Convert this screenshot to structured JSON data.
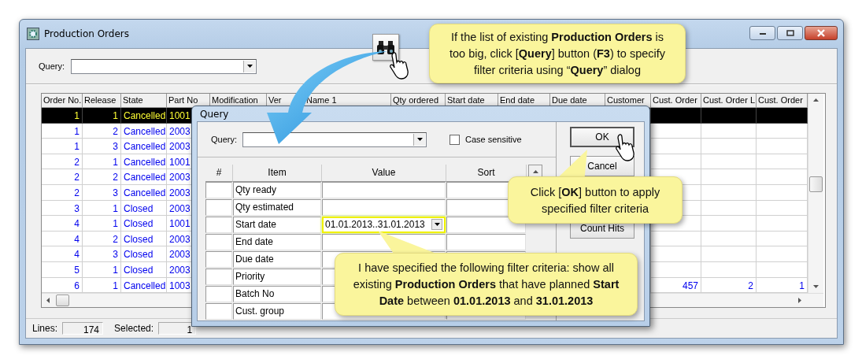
{
  "window": {
    "title": "Production Orders"
  },
  "query": {
    "label": "Query:"
  },
  "table": {
    "columns": [
      "Order No.",
      "Release",
      "State",
      "Part No",
      "Modification",
      "Ver",
      "Name 1",
      "Qty ordered",
      "Start date",
      "End date",
      "Due date",
      "Customer",
      "Cust. Order",
      "Cust. Order L",
      "Cust. Order"
    ],
    "rows": [
      {
        "order_no": "1",
        "release": "1",
        "state": "Cancelled",
        "part_no": "1001",
        "selected": true
      },
      {
        "order_no": "1",
        "release": "2",
        "state": "Cancelled",
        "part_no": "2003",
        "selected": false
      },
      {
        "order_no": "1",
        "release": "3",
        "state": "Cancelled",
        "part_no": "2003",
        "selected": false
      },
      {
        "order_no": "2",
        "release": "1",
        "state": "Cancelled",
        "part_no": "1001",
        "selected": false
      },
      {
        "order_no": "2",
        "release": "2",
        "state": "Cancelled",
        "part_no": "2003",
        "selected": false
      },
      {
        "order_no": "2",
        "release": "3",
        "state": "Cancelled",
        "part_no": "2003",
        "selected": false
      },
      {
        "order_no": "3",
        "release": "1",
        "state": "Closed",
        "part_no": "2003",
        "selected": false
      },
      {
        "order_no": "4",
        "release": "1",
        "state": "Closed",
        "part_no": "1001",
        "selected": false
      },
      {
        "order_no": "4",
        "release": "2",
        "state": "Closed",
        "part_no": "2003",
        "selected": false
      },
      {
        "order_no": "4",
        "release": "3",
        "state": "Closed",
        "part_no": "2003",
        "selected": false
      },
      {
        "order_no": "5",
        "release": "1",
        "state": "Closed",
        "part_no": "2003",
        "selected": false
      },
      {
        "order_no": "6",
        "release": "1",
        "state": "Cancelled",
        "part_no": "1003",
        "cust_order": "457",
        "cust_order_line": "2",
        "cust_order_2": "1",
        "selected": false
      }
    ]
  },
  "status_bar": {
    "lines_label": "Lines:",
    "lines": "174",
    "selected_label": "Selected:",
    "selected": "1"
  },
  "dialog": {
    "title": "Query",
    "query_label": "Query:",
    "case_sensitive": {
      "label": "Case sensitive",
      "checked": false
    },
    "columns": [
      "#",
      "Item",
      "Value",
      "Sort"
    ],
    "rows": [
      {
        "item": "Qty ready",
        "highlighted": false
      },
      {
        "item": "Qty estimated",
        "highlighted": false
      },
      {
        "item": "Start date",
        "value": "01.01.2013..31.01.2013",
        "highlighted": true
      },
      {
        "item": "End date",
        "highlighted": false
      },
      {
        "item": "Due date",
        "highlighted": false
      },
      {
        "item": "Priority",
        "highlighted": false
      },
      {
        "item": "Batch No",
        "highlighted": false
      },
      {
        "item": "Cust. group",
        "highlighted": false
      }
    ],
    "buttons": [
      {
        "label": "OK",
        "focused": true
      },
      {
        "label": "Cancel",
        "focused": false
      },
      {
        "label": "Count Hits",
        "focused": false
      }
    ]
  },
  "callouts": [
    {
      "text": "If the list of existing **Production Orders** is too big, click [**Query**] button (**F3**) to specify filter criteria using “**Query**” dialog"
    },
    {
      "text": "Click [**OK**] button to apply specified filter criteria"
    },
    {
      "text": "I have specified the following filter criteria: show all existing **Production  Orders** that have planned **Start Date** between **01.01.2013** and **31.01.2013**"
    }
  ]
}
